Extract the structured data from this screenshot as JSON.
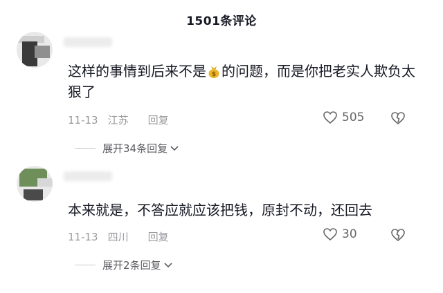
{
  "header": {
    "title": "1501条评论"
  },
  "comments": [
    {
      "text_before": "这样的事情到后来不是",
      "money_icon": "money-bag-icon",
      "text_after": "的问题，而是你把老实人欺负太狠了",
      "date": "11-13",
      "location": "江苏",
      "reply_label": "回复",
      "likes": "505",
      "expand_label": "展开34条回复"
    },
    {
      "text": "本来就是，不答应就应该把钱，原封不动，还回去",
      "date": "11-13",
      "location": "四川",
      "reply_label": "回复",
      "likes": "30",
      "expand_label": "展开2条回复"
    }
  ]
}
